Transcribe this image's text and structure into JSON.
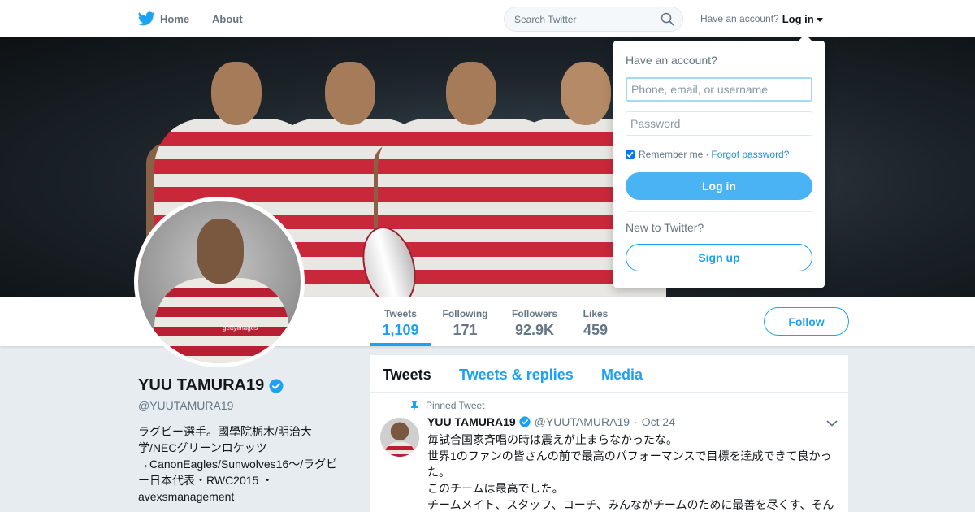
{
  "topbar": {
    "home_label": "Home",
    "about_label": "About",
    "search_placeholder": "Search Twitter",
    "have_account": "Have an account?",
    "login_label": "Log in"
  },
  "login_dropdown": {
    "title": "Have an account?",
    "username_placeholder": "Phone, email, or username",
    "password_placeholder": "Password",
    "remember_label": "Remember me",
    "separator": "·",
    "forgot_label": "Forgot password?",
    "login_button": "Log in",
    "new_prompt": "New to Twitter?",
    "signup_button": "Sign up"
  },
  "profile": {
    "name": "YUU TAMURA19",
    "handle": "@YUUTAMURA19",
    "bio": "ラグビー選手。國學院栃木/明治大学/NECグリーンロケッツ→CanonEagles/Sunwolves16〜/ラグビー日本代表・RWC2015 ・avexsmanagement",
    "avatar_watermark": "gettyimages"
  },
  "stats": [
    {
      "label": "Tweets",
      "value": "1,109"
    },
    {
      "label": "Following",
      "value": "171"
    },
    {
      "label": "Followers",
      "value": "92.9K"
    },
    {
      "label": "Likes",
      "value": "459"
    }
  ],
  "follow_button": "Follow",
  "timeline": {
    "tabs": [
      "Tweets",
      "Tweets & replies",
      "Media"
    ],
    "pinned_label": "Pinned Tweet",
    "tweet": {
      "name": "YUU TAMURA19",
      "handle": "@YUUTAMURA19",
      "dot": "·",
      "date": "Oct 24",
      "lines": [
        "毎試合国家斉唱の時は震えが止まらなかったな。",
        "世界1のファンの皆さんの前で最高のパフォーマンスで目標を達成できて良かった。",
        "このチームは最高でした。",
        "チームメイト、スタッフ、コーチ、みんながチームのために最善を尽くす、そん"
      ]
    }
  },
  "colors": {
    "brand_blue": "#1da1f2",
    "login_button": "#4ab3f4",
    "background": "#e6ecf0",
    "jersey_red": "#c9283a"
  },
  "icons": [
    "twitter-bird-icon",
    "search-icon",
    "caret-down-icon",
    "verified-badge-icon",
    "pin-icon",
    "chevron-down-icon"
  ]
}
